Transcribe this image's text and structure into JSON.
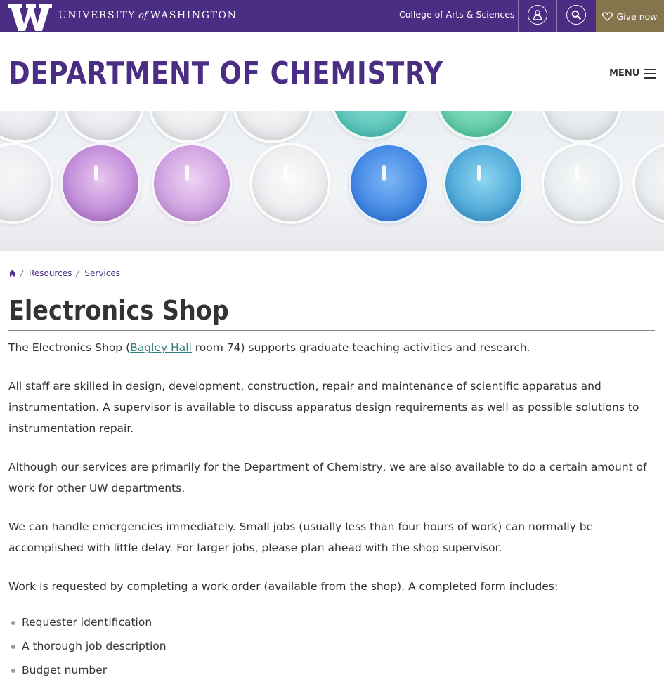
{
  "topbar": {
    "wordmark_left": "UNIVERSITY",
    "wordmark_of": "of",
    "wordmark_right": "WASHINGTON",
    "college_link": "College of Arts & Sciences",
    "give_label": "Give now",
    "colors": {
      "purple": "#4b2e83",
      "gold": "#85754d"
    },
    "icons": [
      "uw-w-logo-icon",
      "user-icon",
      "search-icon",
      "heart-icon"
    ]
  },
  "header": {
    "dept_title": "DEPARTMENT OF CHEMISTRY",
    "menu_label": "MENU"
  },
  "breadcrumb": {
    "home_icon": "home-icon",
    "items": [
      {
        "label": "Resources"
      },
      {
        "label": "Services"
      }
    ],
    "separator": "/"
  },
  "page": {
    "title": "Electronics Shop",
    "intro_before": "The Electronics Shop (",
    "intro_link": "Bagley Hall",
    "intro_after": " room 74) supports graduate teaching activities and research.",
    "paragraphs": [
      "All staff are skilled in design, development, construction, repair and maintenance of scientific apparatus and instrumentation. A supervisor is available to discuss apparatus design requirements as well as possible solutions to instrumentation repair.",
      "Although our services are primarily for the Department of Chemistry, we are also available to do a certain amount of work for other UW departments.",
      "We can handle emergencies immediately. Small jobs (usually less than four hours of work) can normally be accomplished with little delay. For larger jobs, please plan ahead with the shop supervisor.",
      "Work is requested by completing a work order (available from the shop). A completed form includes:"
    ],
    "list": [
      "Requester identification",
      "A thorough job description",
      "Budget number"
    ]
  }
}
